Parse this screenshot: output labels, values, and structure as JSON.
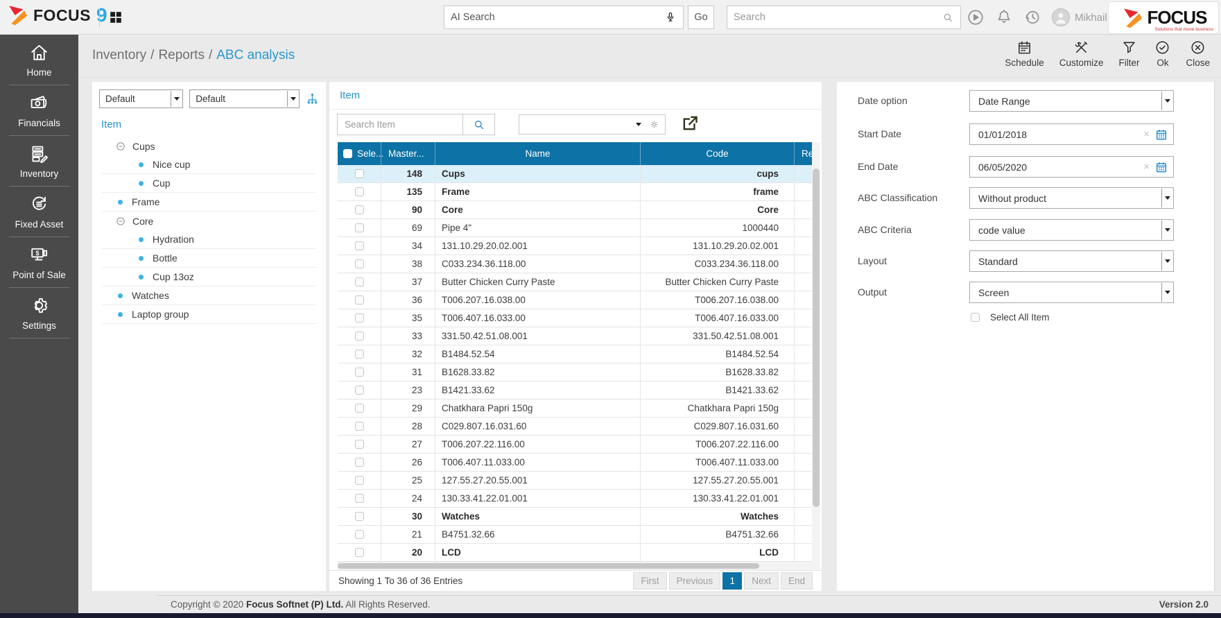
{
  "topbar": {
    "brand": {
      "name": "FOCUS",
      "nine": "9"
    },
    "ai_search": {
      "placeholder": "AI Search",
      "go": "Go",
      "mic_icon": "mic-icon"
    },
    "search": {
      "placeholder": "Search",
      "icon": "magnifier-icon"
    },
    "icons": [
      "play-icon",
      "bell-icon",
      "history-icon"
    ],
    "user": {
      "name": "Mikhail",
      "avatar_icon": "person-icon",
      "caret_icon": "caret-down-icon"
    },
    "logo": {
      "name": "FOCUS",
      "tagline": "Solutions that move business"
    }
  },
  "breadcrumb": {
    "separator": "/",
    "items": [
      {
        "label": "Inventory",
        "active": false
      },
      {
        "label": "Reports",
        "active": false
      },
      {
        "label": "ABC analysis",
        "active": true
      }
    ]
  },
  "toolbar": {
    "actions": [
      {
        "id": "schedule",
        "label": "Schedule",
        "icon": "calendar-icon"
      },
      {
        "id": "customize",
        "label": "Customize",
        "icon": "tools-icon"
      },
      {
        "id": "filter",
        "label": "Filter",
        "icon": "funnel-icon"
      },
      {
        "id": "ok",
        "label": "Ok",
        "icon": "check-circle-icon"
      },
      {
        "id": "close",
        "label": "Close",
        "icon": "close-circle-icon"
      }
    ]
  },
  "sidebar": {
    "items": [
      {
        "label": "Home",
        "icon": "home-icon"
      },
      {
        "label": "Financials",
        "icon": "financials-icon"
      },
      {
        "label": "Inventory",
        "icon": "inventory-icon"
      },
      {
        "label": "Fixed Asset",
        "icon": "fixed-asset-icon"
      },
      {
        "label": "Point of Sale",
        "icon": "pos-icon"
      },
      {
        "label": "Settings",
        "icon": "gear-icon"
      }
    ]
  },
  "filter_panel": {
    "selects": [
      {
        "value": "Default"
      },
      {
        "value": "Default"
      }
    ],
    "tree_icon": "org-chart-icon",
    "title": "Item",
    "tree": [
      {
        "label": "Cups",
        "type": "group",
        "expanded": true,
        "children": [
          {
            "label": "Nice cup"
          },
          {
            "label": "Cup"
          }
        ]
      },
      {
        "label": "Frame",
        "type": "leaf"
      },
      {
        "label": "Core",
        "type": "group",
        "expanded": true,
        "children": [
          {
            "label": "Hydration"
          },
          {
            "label": "Bottle"
          },
          {
            "label": "Cup 13oz"
          }
        ]
      },
      {
        "label": "Watches",
        "type": "leaf"
      },
      {
        "label": "Laptop group",
        "type": "leaf"
      }
    ]
  },
  "item_panel": {
    "title": "Item",
    "search_placeholder": "Search Item",
    "export_icon": "export-icon",
    "combo_icons": [
      "caret-down-icon",
      "gear-small-icon"
    ],
    "table": {
      "columns": [
        "Sele...",
        "Master...",
        "Name",
        "Code",
        "Re"
      ],
      "rows": [
        {
          "master": "148",
          "name": "Cups",
          "code": "cups",
          "bold": true,
          "selected": true
        },
        {
          "master": "135",
          "name": "Frame",
          "code": "frame",
          "bold": true,
          "selected": false
        },
        {
          "master": "90",
          "name": "Core",
          "code": "Core",
          "bold": true,
          "selected": false
        },
        {
          "master": "69",
          "name": "Pipe 4\"",
          "code": "1000440",
          "bold": false,
          "selected": false
        },
        {
          "master": "34",
          "name": "131.10.29.20.02.001",
          "code": "131.10.29.20.02.001",
          "bold": false,
          "selected": false
        },
        {
          "master": "38",
          "name": "C033.234.36.118.00",
          "code": "C033.234.36.118.00",
          "bold": false,
          "selected": false
        },
        {
          "master": "37",
          "name": "Butter Chicken Curry Paste",
          "code": "Butter Chicken Curry Paste",
          "bold": false,
          "selected": false
        },
        {
          "master": "36",
          "name": "T006.207.16.038.00",
          "code": "T006.207.16.038.00",
          "bold": false,
          "selected": false
        },
        {
          "master": "35",
          "name": "T006.407.16.033.00",
          "code": "T006.407.16.033.00",
          "bold": false,
          "selected": false
        },
        {
          "master": "33",
          "name": "331.50.42.51.08.001",
          "code": "331.50.42.51.08.001",
          "bold": false,
          "selected": false
        },
        {
          "master": "32",
          "name": "B1484.52.54",
          "code": "B1484.52.54",
          "bold": false,
          "selected": false
        },
        {
          "master": "31",
          "name": "B1628.33.82",
          "code": "B1628.33.82",
          "bold": false,
          "selected": false
        },
        {
          "master": "23",
          "name": "B1421.33.62",
          "code": "B1421.33.62",
          "bold": false,
          "selected": false
        },
        {
          "master": "29",
          "name": "Chatkhara Papri 150g",
          "code": "Chatkhara Papri 150g",
          "bold": false,
          "selected": false
        },
        {
          "master": "28",
          "name": "C029.807.16.031.60",
          "code": "C029.807.16.031.60",
          "bold": false,
          "selected": false
        },
        {
          "master": "27",
          "name": "T006.207.22.116.00",
          "code": "T006.207.22.116.00",
          "bold": false,
          "selected": false
        },
        {
          "master": "26",
          "name": "T006.407.11.033.00",
          "code": "T006.407.11.033.00",
          "bold": false,
          "selected": false
        },
        {
          "master": "25",
          "name": "127.55.27.20.55.001",
          "code": "127.55.27.20.55.001",
          "bold": false,
          "selected": false
        },
        {
          "master": "24",
          "name": "130.33.41.22.01.001",
          "code": "130.33.41.22.01.001",
          "bold": false,
          "selected": false
        },
        {
          "master": "30",
          "name": "Watches",
          "code": "Watches",
          "bold": true,
          "selected": false
        },
        {
          "master": "21",
          "name": "B4751.32.66",
          "code": "B4751.32.66",
          "bold": false,
          "selected": false
        },
        {
          "master": "20",
          "name": "LCD",
          "code": "LCD",
          "bold": true,
          "selected": false
        }
      ]
    },
    "pagination": {
      "summary": "Showing 1 To 36 of 36 Entries",
      "buttons": [
        "First",
        "Previous",
        "1",
        "Next",
        "End"
      ],
      "active": "1"
    }
  },
  "params_panel": {
    "fields": [
      {
        "label": "Date option",
        "type": "select",
        "value": "Date Range"
      },
      {
        "label": "Start Date",
        "type": "date",
        "value": "01/01/2018"
      },
      {
        "label": "End Date",
        "type": "date",
        "value": "06/05/2020"
      },
      {
        "label": "ABC Classification",
        "type": "select",
        "value": "Without product"
      },
      {
        "label": "ABC Criteria",
        "type": "select",
        "value": "code value"
      },
      {
        "label": "Layout",
        "type": "select",
        "value": "Standard"
      },
      {
        "label": "Output",
        "type": "select",
        "value": "Screen"
      }
    ],
    "select_all": {
      "label": "Select All Item",
      "checked": false
    }
  },
  "footer": {
    "copyright_prefix": "Copyright © 2020 ",
    "company": "Focus Softnet (P) Ltd.",
    "suffix": " All Rights Reserved.",
    "version": "Version 2.0"
  },
  "colors": {
    "table_header_blue": "#0d72a5",
    "link_blue": "#2a97cf",
    "selected_row": "#dcf0fa",
    "sidebar_bg": "#4a4a4b",
    "accent_bullet": "#3cb3e8",
    "logo_red": "#e8262d",
    "logo_orange": "#f6921e"
  }
}
